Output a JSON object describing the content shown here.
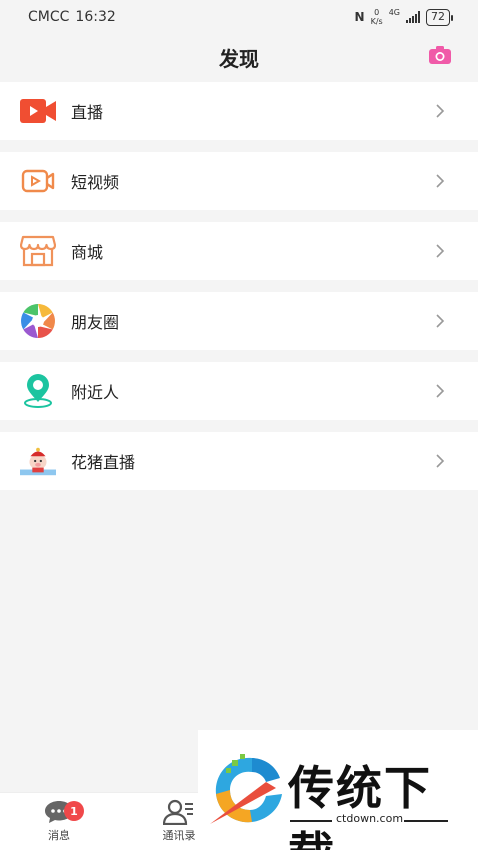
{
  "status_bar": {
    "carrier": "CMCC",
    "time": "16:32",
    "speed_value": "0",
    "speed_unit": "K/s",
    "network": "4G",
    "battery": "72"
  },
  "header": {
    "title": "发现"
  },
  "menu": [
    {
      "label": "直播",
      "icon": "live-video-icon"
    },
    {
      "label": "短视频",
      "icon": "short-video-icon"
    },
    {
      "label": "商城",
      "icon": "store-icon"
    },
    {
      "label": "朋友圈",
      "icon": "moments-icon"
    },
    {
      "label": "附近人",
      "icon": "nearby-location-icon"
    },
    {
      "label": "花猪直播",
      "icon": "huazhu-live-icon"
    }
  ],
  "bottom_nav": {
    "messages_label": "消息",
    "messages_badge": "1",
    "contacts_label": "通讯录"
  },
  "watermark": {
    "title": "传统下载",
    "url": "ctdown.com"
  },
  "colors": {
    "live_red": "#f04e32",
    "short_video_orange": "#f08a4b",
    "store_orange": "#f0925a",
    "nearby_teal": "#1cc4a0",
    "camera_pink": "#f05aa8",
    "badge_red": "#f0484a"
  }
}
